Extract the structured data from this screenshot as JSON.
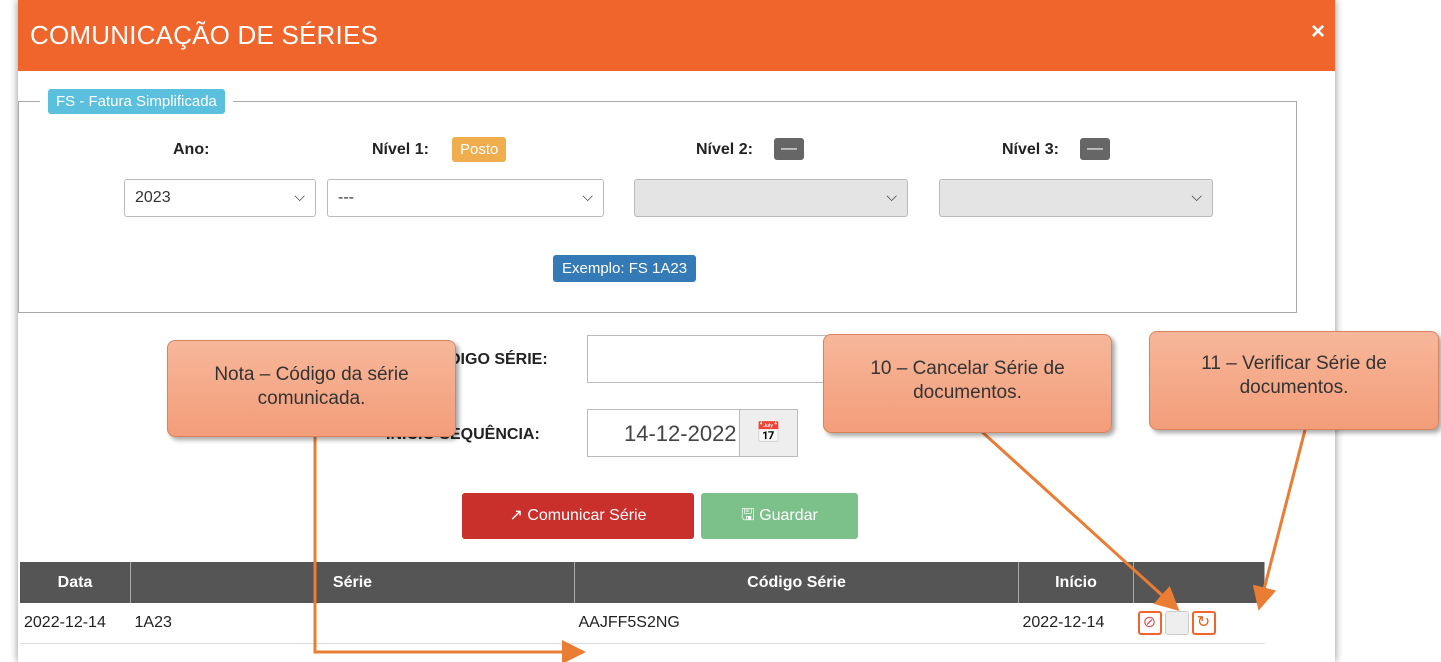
{
  "modal": {
    "title": "COMUNICAÇÃO DE SÉRIES",
    "close_label": "×"
  },
  "section": {
    "legend": "FS - Fatura Simplificada",
    "ano_label": "Ano:",
    "nivel1_label": "Nível 1:",
    "nivel1_badge": "Posto",
    "nivel2_label": "Nível 2:",
    "nivel2_badge": "—",
    "nivel3_label": "Nível 3:",
    "nivel3_badge": "—",
    "ano_value": "2023",
    "nivel1_value": "---",
    "nivel2_value": "",
    "nivel3_value": "",
    "example": "Exemplo: FS 1A23"
  },
  "form": {
    "codigo_label": "CÓDIGO SÉRIE:",
    "codigo_value": "",
    "inicio_label": "INÍCIO SEQUÊNCIA:",
    "inicio_value": "14-12-2022"
  },
  "buttons": {
    "comunicar": "Comunicar Série",
    "guardar": "Guardar"
  },
  "table": {
    "headers": [
      "Data",
      "Série",
      "Código Série",
      "Início",
      ""
    ],
    "rows": [
      {
        "data": "2022-12-14",
        "serie": "1A23",
        "codigo": "AAJFF5S2NG",
        "inicio": "2022-12-14"
      }
    ]
  },
  "callouts": {
    "nota": "Nota – Código da série comunicada.",
    "cancelar": "10 – Cancelar Série de documentos.",
    "verificar": "11 – Verificar Série de documentos."
  },
  "icons": {
    "calendar": "calendar-icon",
    "external": "external-link-icon",
    "save": "save-icon",
    "cancel": "ban-icon",
    "refresh": "refresh-icon"
  }
}
